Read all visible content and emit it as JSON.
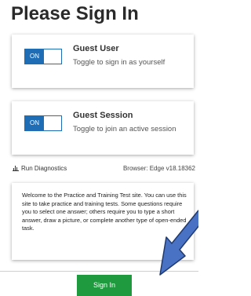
{
  "page": {
    "title": "Please Sign In"
  },
  "guest_user": {
    "toggle_label": "ON",
    "title": "Guest User",
    "description": "Toggle to sign in as yourself"
  },
  "guest_session": {
    "toggle_label": "ON",
    "title": "Guest Session",
    "description": "Toggle to join an active session"
  },
  "diagnostics": {
    "link_label": "Run Diagnostics",
    "icon": "bar-chart-icon"
  },
  "browser": {
    "info": "Browser: Edge v18.18362"
  },
  "welcome": {
    "text": "Welcome to the Practice and Training Test site. You can use this site to take practice and training tests. Some questions require you to select one answer; others require you to type a short answer, draw a picture, or complete another type of open-ended task."
  },
  "footer": {
    "sign_in_label": "Sign In"
  },
  "colors": {
    "toggle_blue": "#1f6db5",
    "sign_in_green": "#1f9a3f",
    "arrow_blue": "#4a72c4",
    "arrow_border": "#1f3a6e"
  }
}
